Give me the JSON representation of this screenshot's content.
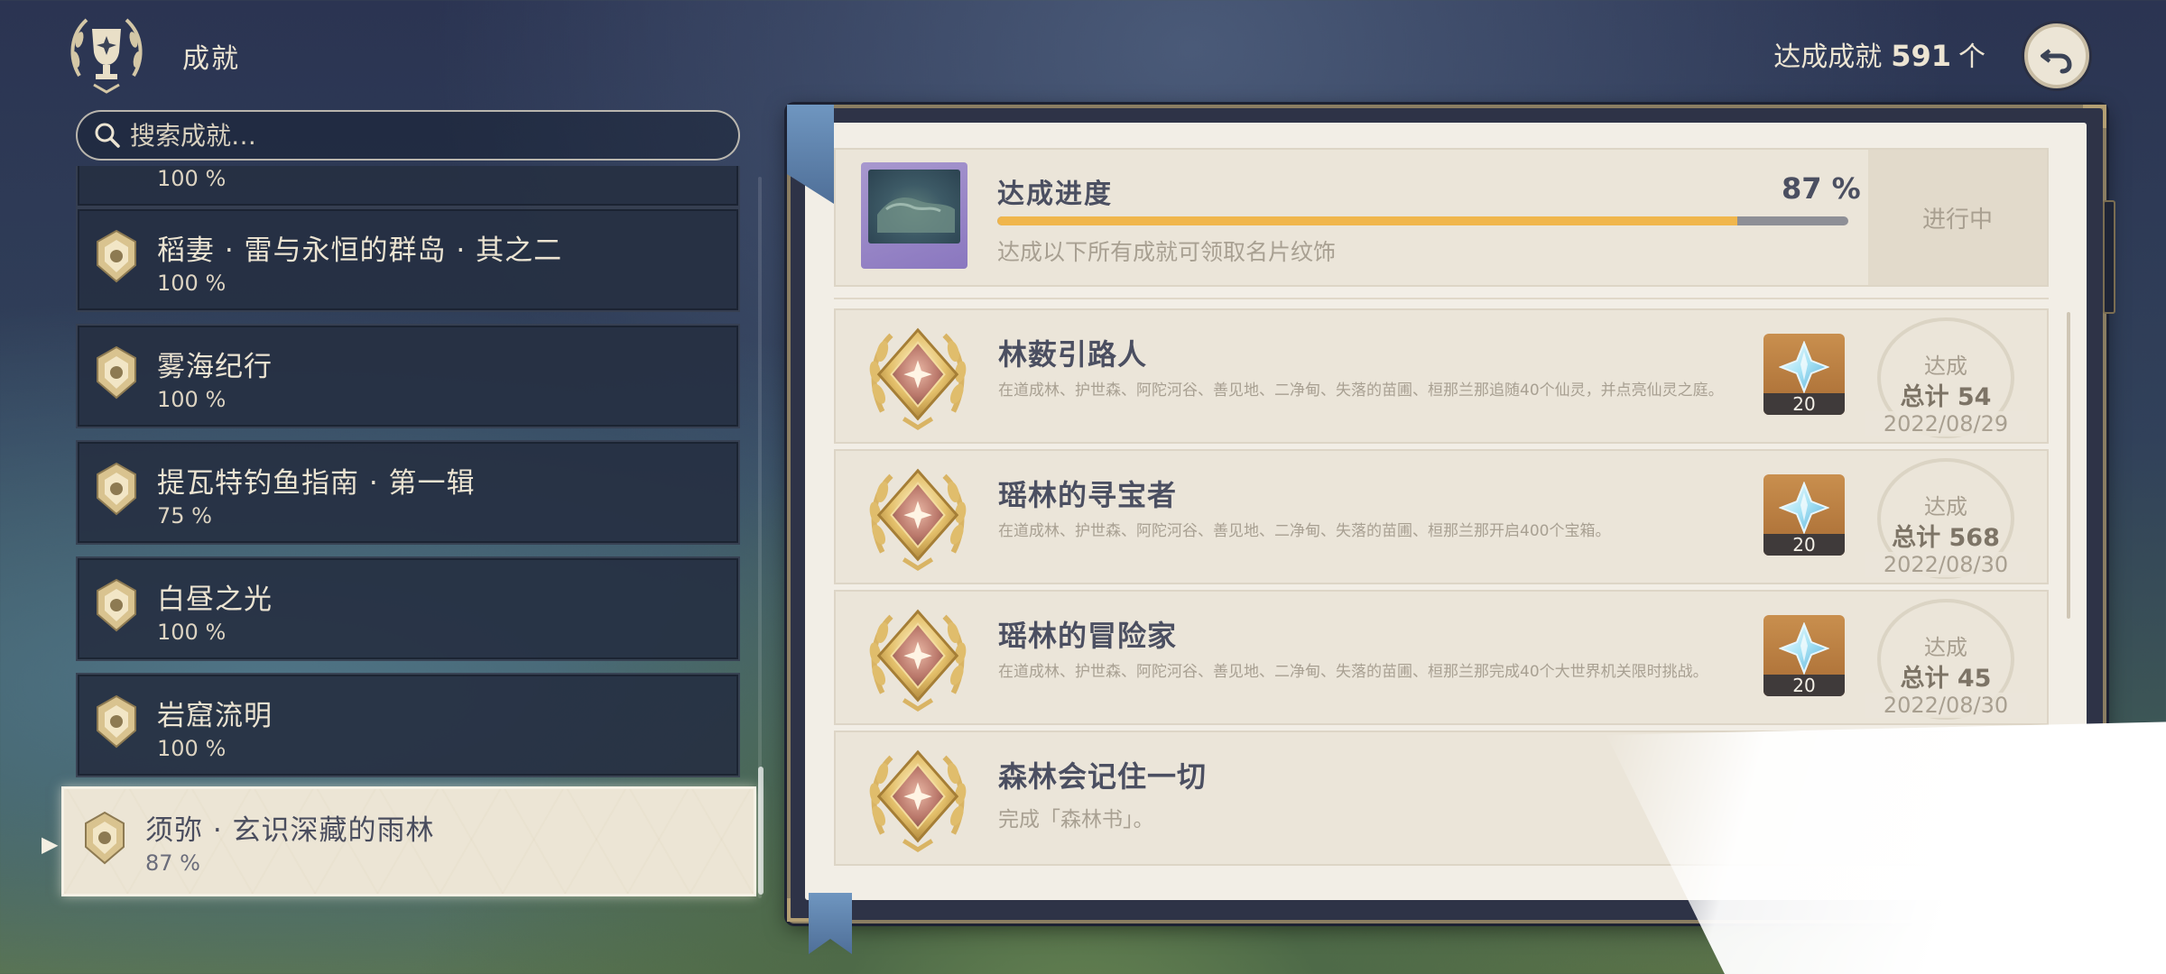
{
  "header": {
    "title": "成就",
    "total_label": "达成成就",
    "total_count": "591",
    "total_unit": "个"
  },
  "search": {
    "placeholder": "搜索成就…"
  },
  "categories": [
    {
      "name": "稻妻 · 雷与永恒的群岛 · 其之二",
      "percent": "100 %"
    },
    {
      "name": "雾海纪行",
      "percent": "100 %"
    },
    {
      "name": "提瓦特钓鱼指南 · 第一辑",
      "percent": "75 %"
    },
    {
      "name": "白昼之光",
      "percent": "100 %"
    },
    {
      "name": "岩窟流明",
      "percent": "100 %"
    },
    {
      "name": "须弥 · 玄识深藏的雨林",
      "percent": "87 %",
      "selected": true
    }
  ],
  "category_partial_top": {
    "percent": "100 %"
  },
  "progress": {
    "title": "达成进度",
    "percent_label": "87 %",
    "fraction": 0.87,
    "description": "达成以下所有成就可领取名片纹饰",
    "status": "进行中"
  },
  "achievements": [
    {
      "title": "林薮引路人",
      "description": "在道成林、护世森、阿陀河谷、善见地、二净甸、失落的苗圃、桓那兰那追随40个仙灵，并点亮仙灵之庭。",
      "reward_qty": "20",
      "status_label": "达成",
      "total": "总计 54",
      "date": "2022/08/29"
    },
    {
      "title": "瑶林的寻宝者",
      "description": "在道成林、护世森、阿陀河谷、善见地、二净甸、失落的苗圃、桓那兰那开启400个宝箱。",
      "reward_qty": "20",
      "status_label": "达成",
      "total": "总计 568",
      "date": "2022/08/30"
    },
    {
      "title": "瑶林的冒险家",
      "description": "在道成林、护世森、阿陀河谷、善见地、二净甸、失落的苗圃、桓那兰那完成40个大世界机关限时挑战。",
      "reward_qty": "20",
      "status_label": "达成",
      "total": "总计 45",
      "date": "2022/08/30"
    },
    {
      "title": "森林会记住一切",
      "description": "完成「森林书」。"
    }
  ],
  "colors": {
    "accent_gold": "#f0b64c",
    "panel_dark": "#263042",
    "page_bg": "#f2eee6",
    "text_dark": "#4b4f61"
  },
  "icons": {
    "header": "trophy-emblem-icon",
    "search": "search-icon",
    "back": "back-arrow-icon",
    "reward": "primogem-icon"
  }
}
